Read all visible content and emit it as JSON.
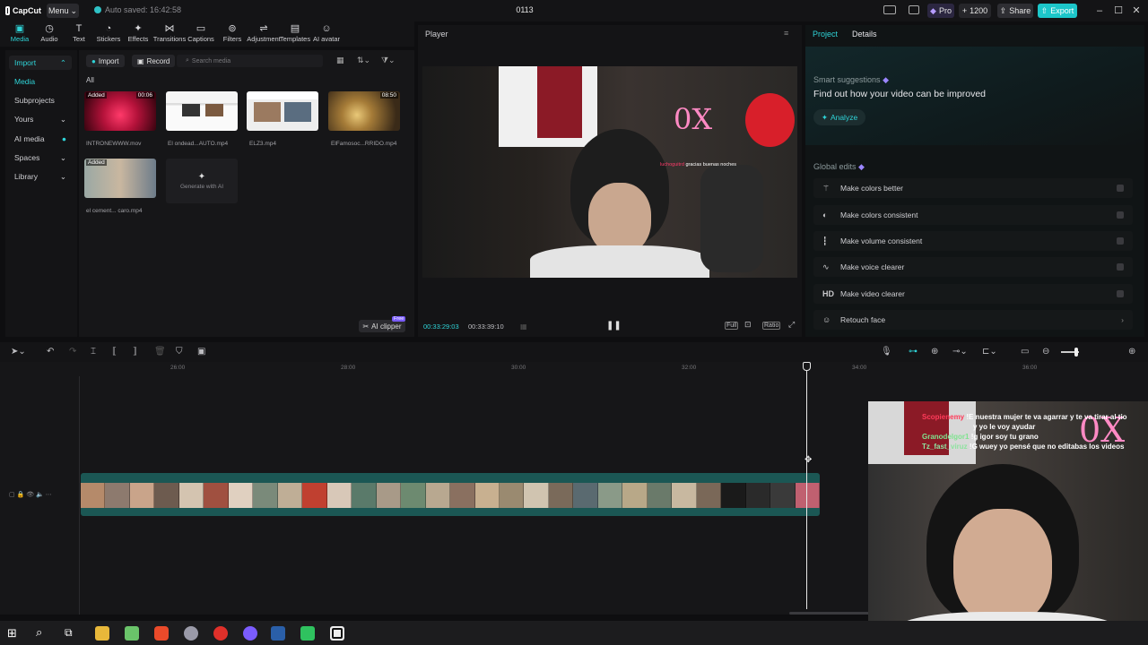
{
  "titlebar": {
    "app_name": "CapCut",
    "menu_label": "Menu",
    "autosave": "Auto saved: 16:42:58",
    "project_title": "0113",
    "pro_label": "Pro",
    "credits": "1200",
    "share_label": "Share",
    "export_label": "Export"
  },
  "toolbar": {
    "tools": [
      {
        "label": "Media",
        "icon": "media-icon"
      },
      {
        "label": "Audio",
        "icon": "audio-icon"
      },
      {
        "label": "Text",
        "icon": "text-icon"
      },
      {
        "label": "Stickers",
        "icon": "stickers-icon"
      },
      {
        "label": "Effects",
        "icon": "effects-icon"
      },
      {
        "label": "Transitions",
        "icon": "transitions-icon"
      },
      {
        "label": "Captions",
        "icon": "captions-icon"
      },
      {
        "label": "Filters",
        "icon": "filters-icon"
      },
      {
        "label": "Adjustment",
        "icon": "adjustment-icon"
      },
      {
        "label": "Templates",
        "icon": "templates-icon"
      },
      {
        "label": "AI avatar",
        "icon": "avatar-icon"
      }
    ]
  },
  "leftpanel": {
    "items": [
      {
        "label": "Import"
      },
      {
        "label": "Media"
      },
      {
        "label": "Subprojects"
      },
      {
        "label": "Yours"
      },
      {
        "label": "AI media"
      },
      {
        "label": "Spaces"
      },
      {
        "label": "Library"
      }
    ]
  },
  "media": {
    "import_label": "Import",
    "record_label": "Record",
    "search_placeholder": "Search media",
    "filter_all": "All",
    "items": [
      {
        "name": "INTRONEWWW.mov",
        "badge": "Added",
        "duration": "00:06"
      },
      {
        "name": "El ondead...AUTO.mp4",
        "badge": "",
        "duration": ""
      },
      {
        "name": "ELZ3.mp4",
        "badge": "",
        "duration": ""
      },
      {
        "name": "ElFamosoc...RRIDO.mp4",
        "badge": "",
        "duration": "08:50"
      },
      {
        "name": "el cement... caro.mp4",
        "badge": "Added",
        "duration": ""
      }
    ],
    "generate_label": "Generate with AI",
    "ai_clipper_label": "AI clipper",
    "free_badge": "Free"
  },
  "player": {
    "title": "Player",
    "current_time": "00:33:29:03",
    "total_time": "00:33:39:10",
    "overlay_text": "gracias buenas noches",
    "overlay_name": "luchoguitrd",
    "ratio_label": "Ratio",
    "full_label": "Full"
  },
  "rightpanel": {
    "tab_project": "Project",
    "tab_details": "Details",
    "smart_title": "Smart suggestions",
    "smart_headline": "Find out how your video can be improved",
    "analyze_label": "Analyze",
    "global_title": "Global edits",
    "global_items": [
      {
        "label": "Make colors better",
        "icon": "wand-icon"
      },
      {
        "label": "Make colors consistent",
        "icon": "palette-icon"
      },
      {
        "label": "Make volume consistent",
        "icon": "volume-bars-icon"
      },
      {
        "label": "Make voice clearer",
        "icon": "voice-icon"
      },
      {
        "label": "Make video clearer",
        "icon": "hd-icon"
      },
      {
        "label": "Retouch face",
        "icon": "face-icon"
      }
    ]
  },
  "timeline": {
    "ruler": [
      "26:00",
      "28:00",
      "30:00",
      "32:00",
      "34:00",
      "36:00"
    ]
  },
  "webcam": {
    "chat": [
      {
        "user": "Scopienemy",
        "msg": "!E nuestra mujer te va agarrar y te va tirar al tio"
      },
      {
        "user": "",
        "msg": "y yo le voy ayudar"
      },
      {
        "user": "Granodelgor1",
        "msg": "!g igor soy tu grano"
      },
      {
        "user": "Tz_fast_viruz",
        "msg": "!G wuey yo pensé que no editabas los videos"
      }
    ]
  },
  "colors": {
    "accent": "#2fd4d8",
    "export": "#1cc6c9",
    "track": "#1b5754"
  }
}
